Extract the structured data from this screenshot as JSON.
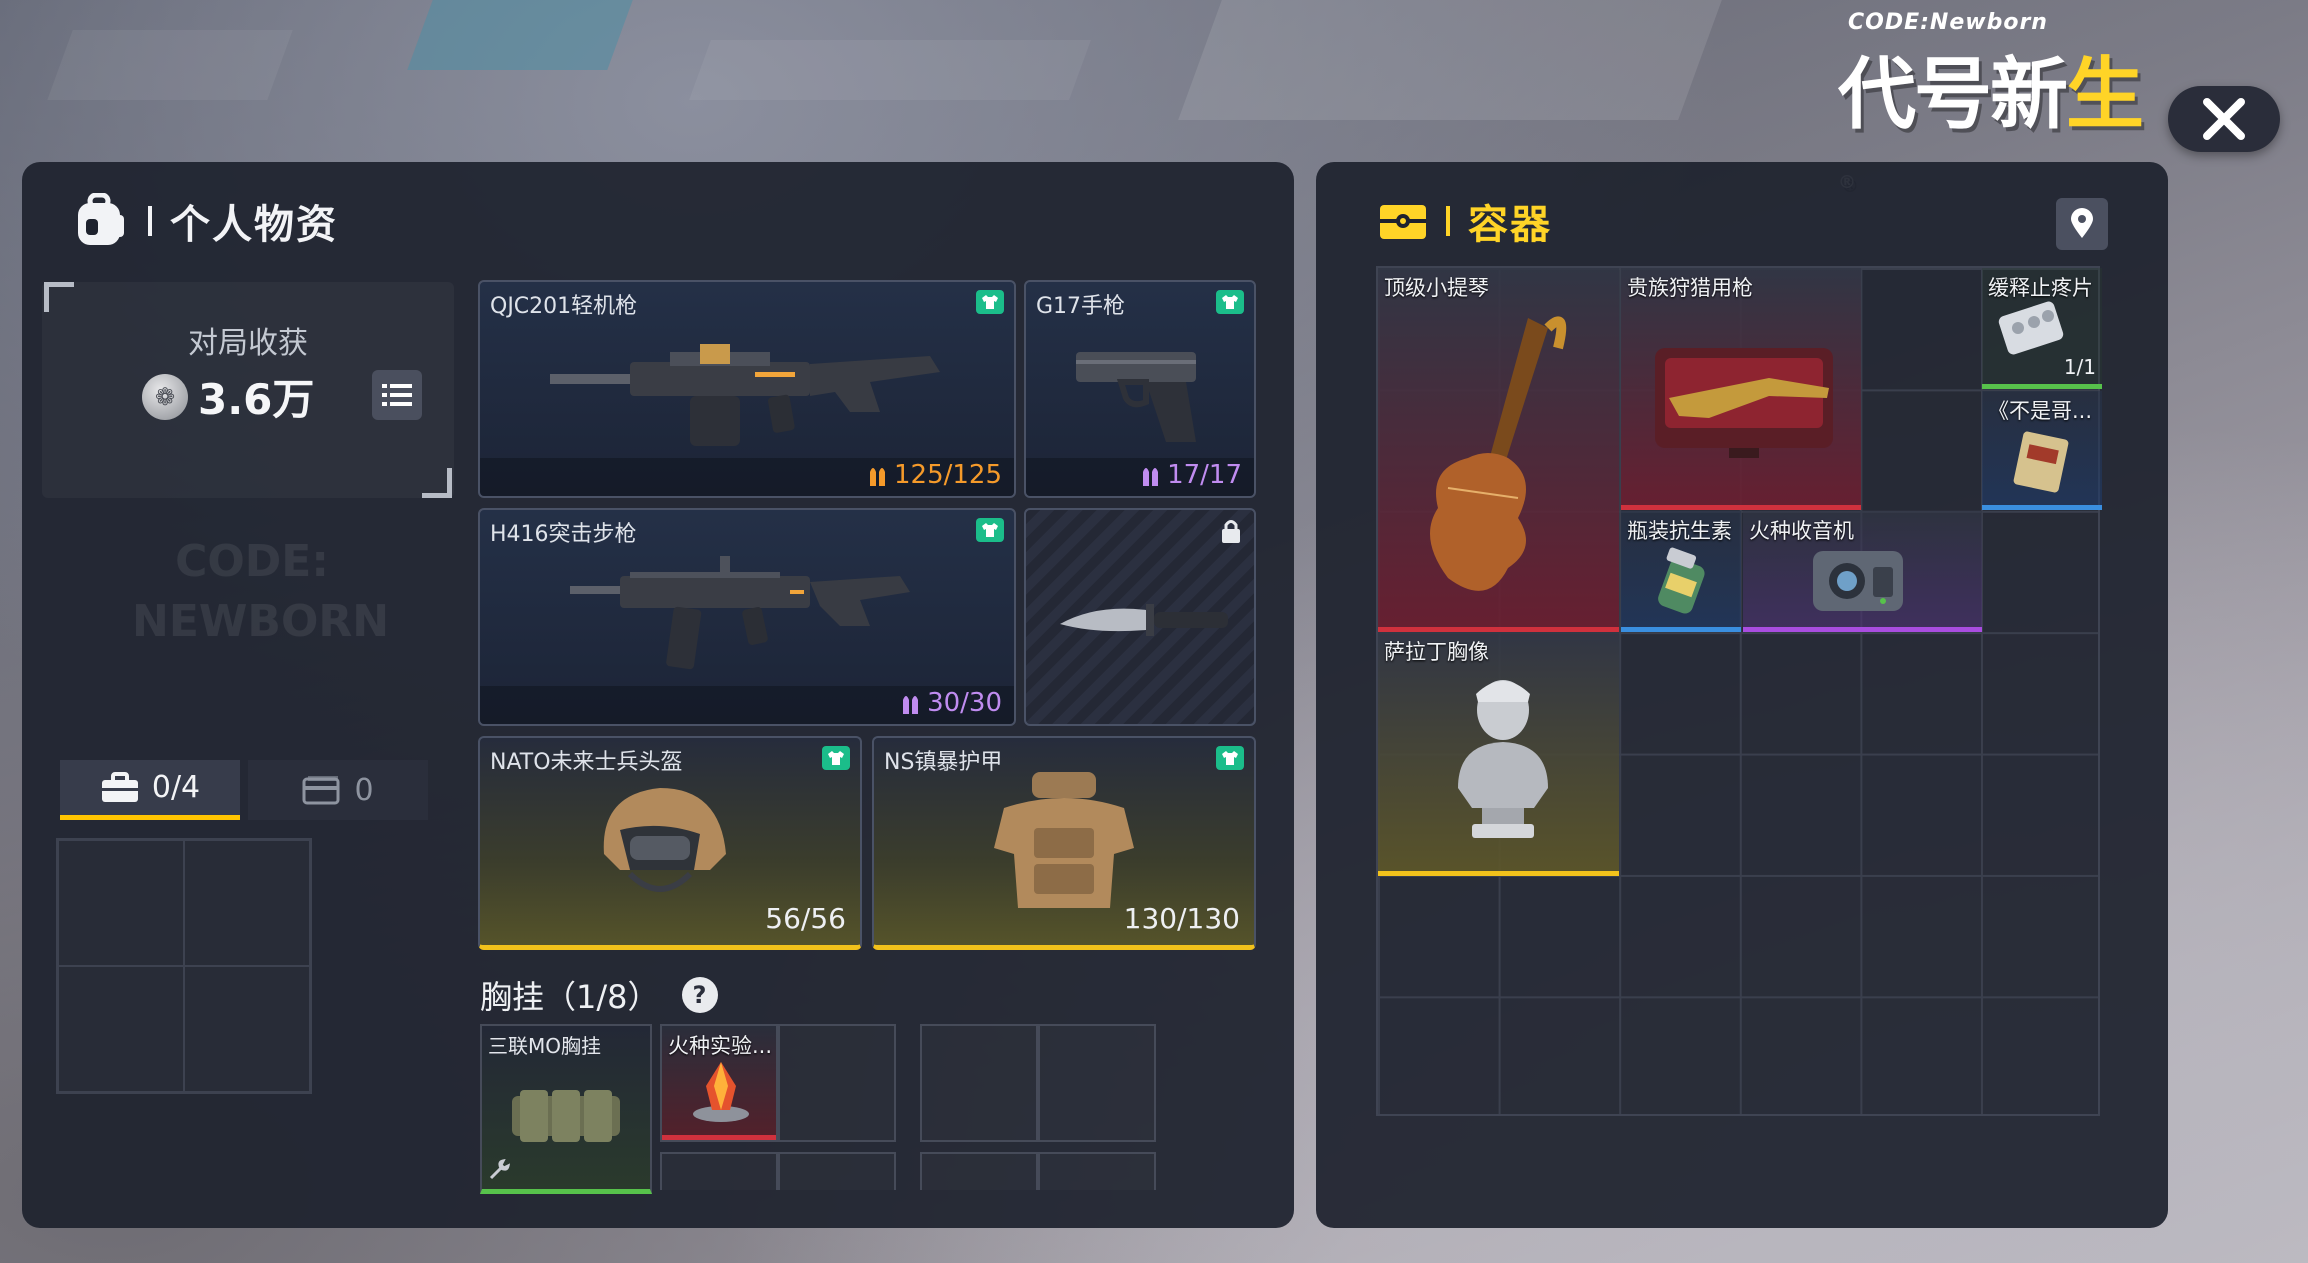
{
  "logo": {
    "code_text": "CODE:Newborn",
    "title_a": "代号新",
    "title_b": "生",
    "reg": "®"
  },
  "left_panel": {
    "title": "个人物资",
    "harvest": {
      "label": "对局收获",
      "value": "3.6万"
    },
    "tabs": [
      {
        "label": "0/4",
        "icon": "briefcase-icon"
      },
      {
        "label": "0",
        "icon": "card-icon"
      }
    ],
    "weapons": {
      "primary1": {
        "name": "QJC201轻机枪",
        "ammo": "125/125"
      },
      "sidearm": {
        "name": "G17手枪",
        "ammo": "17/17"
      },
      "primary2": {
        "name": "H416突击步枪",
        "ammo": "30/30"
      },
      "melee": {
        "icon": "lock-icon"
      }
    },
    "armor": {
      "helmet": {
        "name": "NATO未来士兵头盔",
        "durability": "56/56"
      },
      "vest": {
        "name": "NS镇暴护甲",
        "durability": "130/130"
      }
    },
    "chest_rig": {
      "title": "胸挂（1/8）",
      "help": "?",
      "rig_name": "三联MO胸挂",
      "item_name": "火种实验..."
    }
  },
  "right_panel": {
    "title": "容器",
    "items": [
      {
        "name": "顶级小提琴",
        "rarity_color": "#d0313d"
      },
      {
        "name": "贵族狩猎用枪",
        "rarity_color": "#d0313d"
      },
      {
        "name": "缓释止疼片",
        "qty": "1/1",
        "rarity_color": "#57c24b"
      },
      {
        "name": "《不是哥...",
        "rarity_color": "#3a8fe0"
      },
      {
        "name": "瓶装抗生素",
        "rarity_color": "#3a8fe0"
      },
      {
        "name": "火种收音机",
        "rarity_color": "#a94de0"
      },
      {
        "name": "萨拉丁胸像",
        "rarity_color": "#f2c21b"
      }
    ]
  },
  "colors": {
    "accent": "#ffd427",
    "badge_green": "#1bbd8a",
    "gold_bar": "#f2c21b"
  }
}
